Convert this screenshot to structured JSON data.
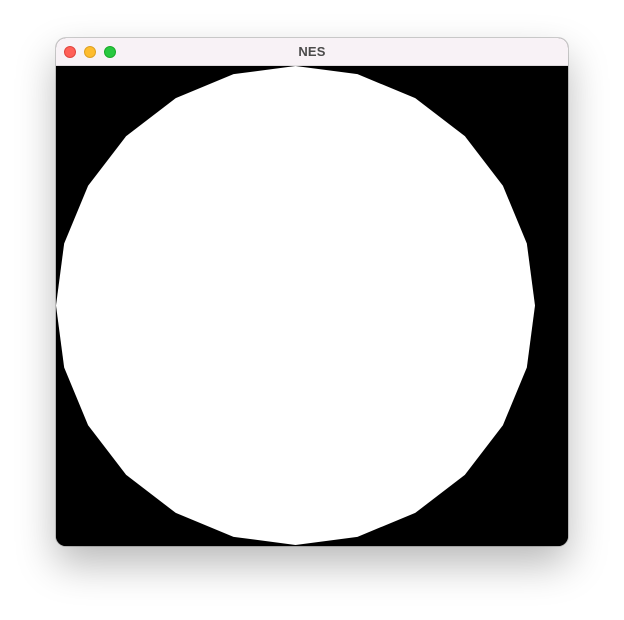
{
  "window": {
    "title": "NES",
    "controls": {
      "close": {
        "icon": "close-icon",
        "color": "#ff5f57"
      },
      "minimize": {
        "icon": "minimize-icon",
        "color": "#febc2e"
      },
      "zoom": {
        "icon": "zoom-icon",
        "color": "#28c840"
      }
    }
  },
  "canvas": {
    "background": "#000000",
    "shape": "circle",
    "shape_color": "#ffffff"
  }
}
